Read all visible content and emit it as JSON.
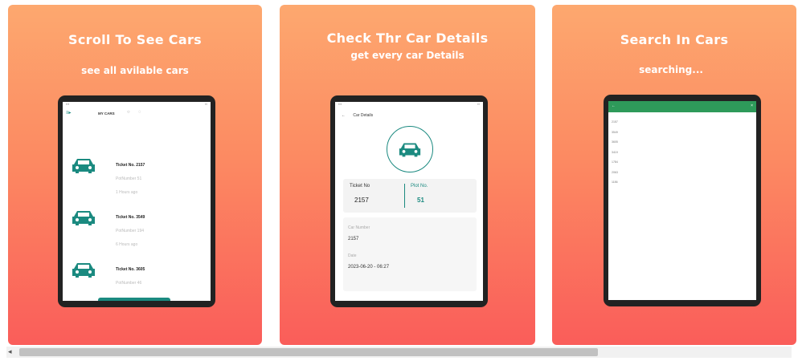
{
  "cards": [
    {
      "title": "Scroll To See Cars",
      "subtitle": "see all avilable cars",
      "screen": {
        "header_title": "MY CARS",
        "rows": [
          {
            "ticket": "Ticket No. 2157",
            "plot": "PotNumber 51",
            "time": "1 Hours ago"
          },
          {
            "ticket": "Ticket No. 3549",
            "plot": "PotNumber 194",
            "time": "6 Hours ago"
          },
          {
            "ticket": "Ticket No. 3605",
            "plot": "PotNumber 46",
            "time": ""
          }
        ]
      }
    },
    {
      "title": "Check Thr Car Details",
      "subtitle": "get every car Details",
      "screen": {
        "header_title": "Car Details",
        "ticket_label": "Ticket No",
        "ticket_value": "2157",
        "plot_label": "Plot No.",
        "plot_value": "51",
        "car_number_label": "Car Number",
        "car_number_value": "2157",
        "date_label": "Date",
        "date_value": "2023-06-20 - 06:27"
      }
    },
    {
      "title": "Search In Cars",
      "subtitle": "searching...",
      "screen": {
        "list": [
          "2157",
          "3549",
          "3605",
          "3419",
          "1784",
          "2063",
          "1186"
        ]
      }
    }
  ],
  "colors": {
    "gradient_top": "#fda86f",
    "gradient_bottom": "#fa5d5a",
    "teal": "#1b8a80",
    "search_bar": "#2e9a5a"
  }
}
